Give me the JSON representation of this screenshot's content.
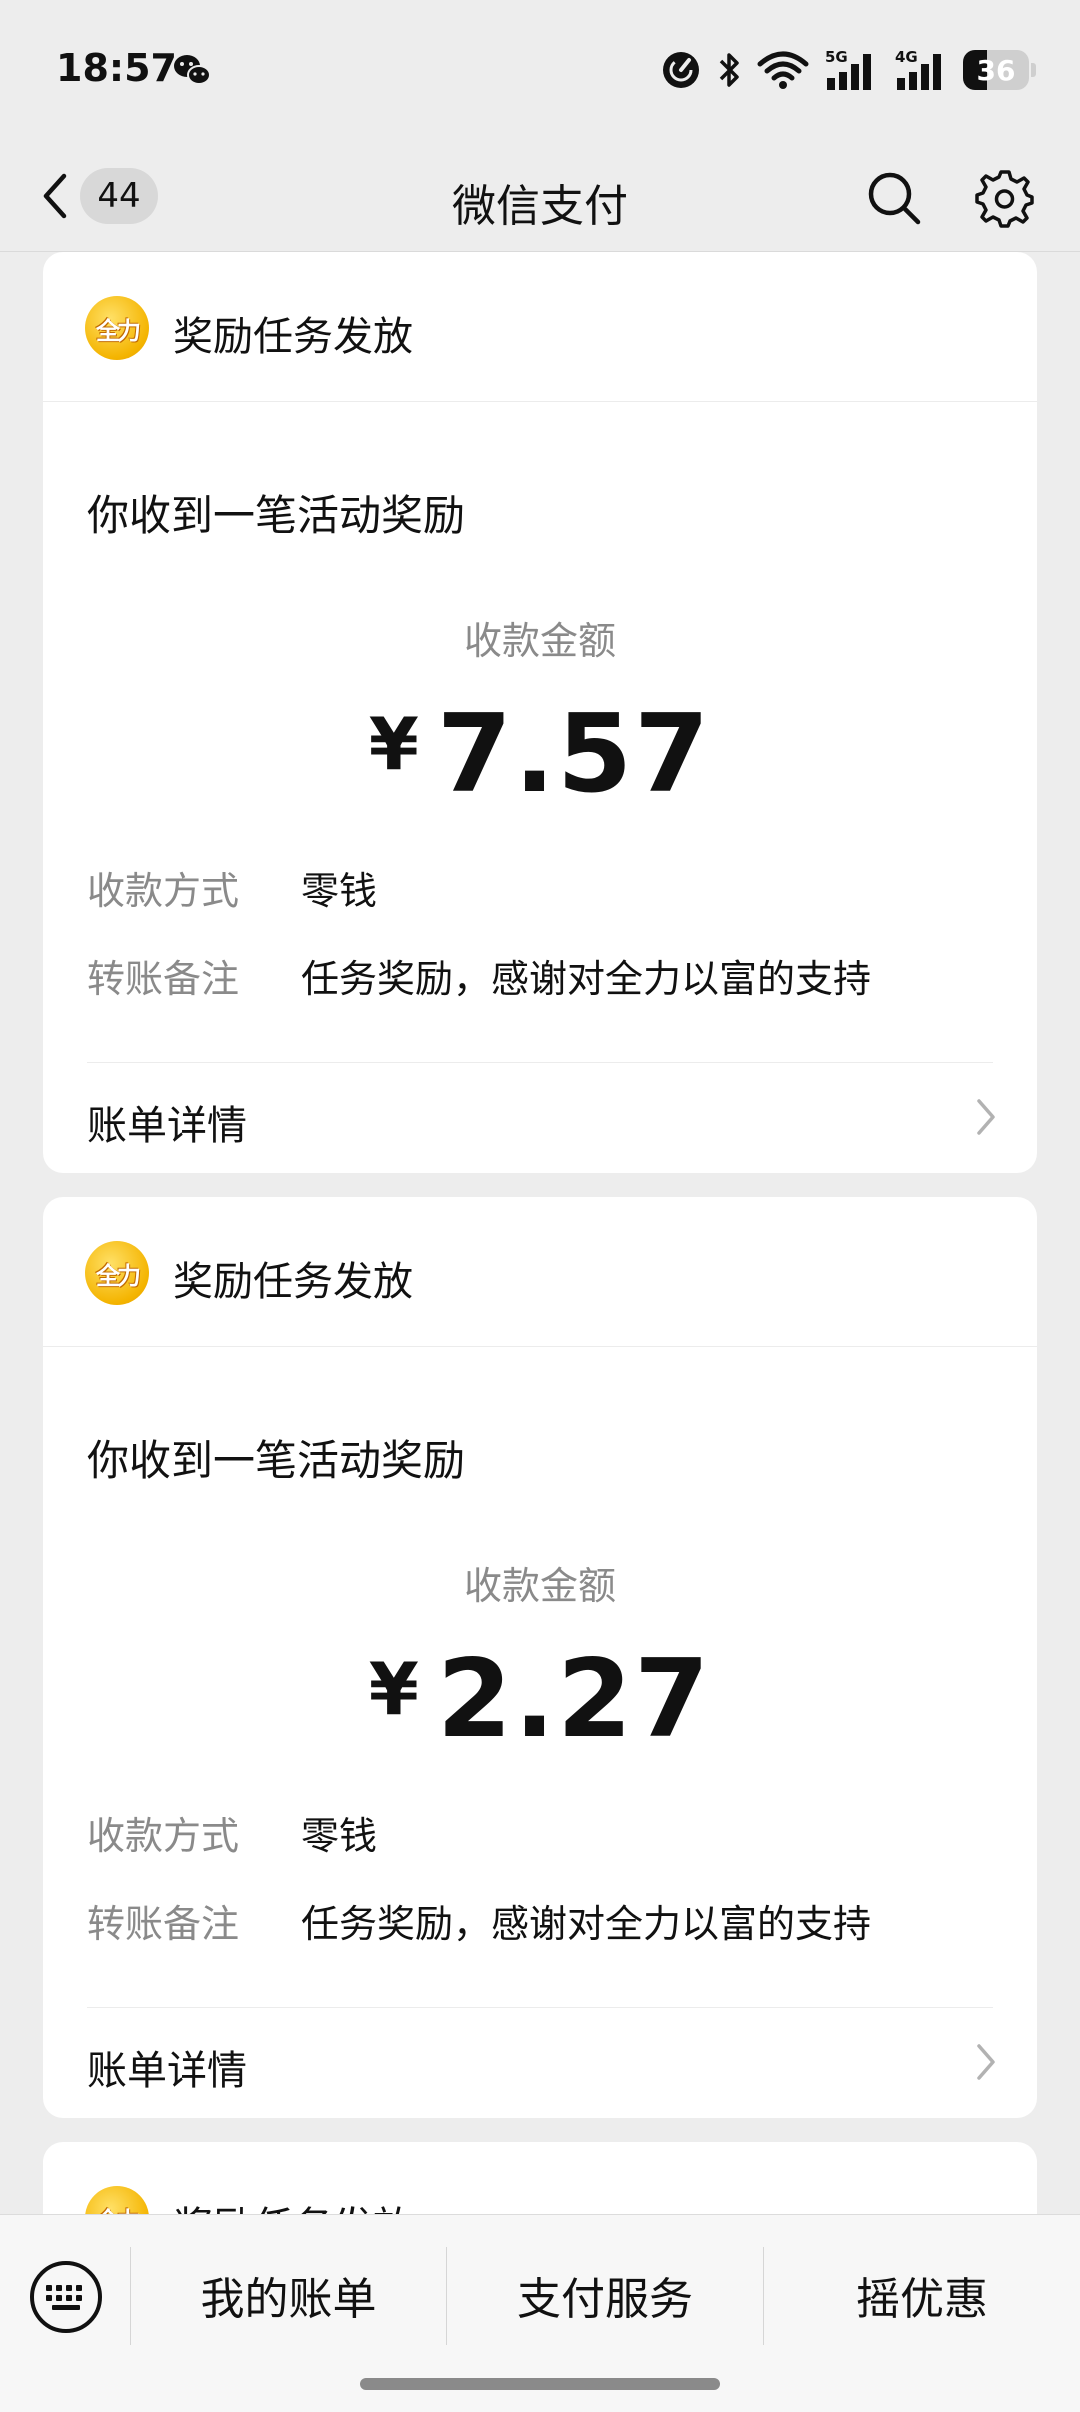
{
  "status_bar": {
    "time": "18:57",
    "battery_level": "36",
    "icons": [
      "wechat-icon",
      "data-saver-icon",
      "bluetooth-icon",
      "wifi-icon",
      "signal-5g-icon",
      "signal-4g-icon",
      "battery-icon"
    ],
    "signal_labels": {
      "first": "5G",
      "second": "4G"
    }
  },
  "nav": {
    "unread_count": "44",
    "title": "微信支付",
    "icons": [
      "back-icon",
      "search-icon",
      "settings-icon"
    ]
  },
  "cards": [
    {
      "source": "奖励任务发放",
      "headline": "你收到一笔活动奖励",
      "amount_label": "收款金额",
      "currency": "¥",
      "amount": "7.57",
      "method_key": "收款方式",
      "method_value": "零钱",
      "note_key": "转账备注",
      "note_value": "任务奖励，感谢对全力以富的支持",
      "detail_label": "账单详情"
    },
    {
      "source": "奖励任务发放",
      "headline": "你收到一笔活动奖励",
      "amount_label": "收款金额",
      "currency": "¥",
      "amount": "2.27",
      "method_key": "收款方式",
      "method_value": "零钱",
      "note_key": "转账备注",
      "note_value": "任务奖励，感谢对全力以富的支持",
      "detail_label": "账单详情"
    },
    {
      "source": "奖励任务发放"
    }
  ],
  "bottom_menu": {
    "items": [
      "我的账单",
      "支付服务",
      "摇优惠"
    ]
  },
  "colors": {
    "background": "#ededed",
    "card": "#ffffff",
    "muted_text": "#8a8a8a",
    "logo_gold": "#f4b400"
  }
}
